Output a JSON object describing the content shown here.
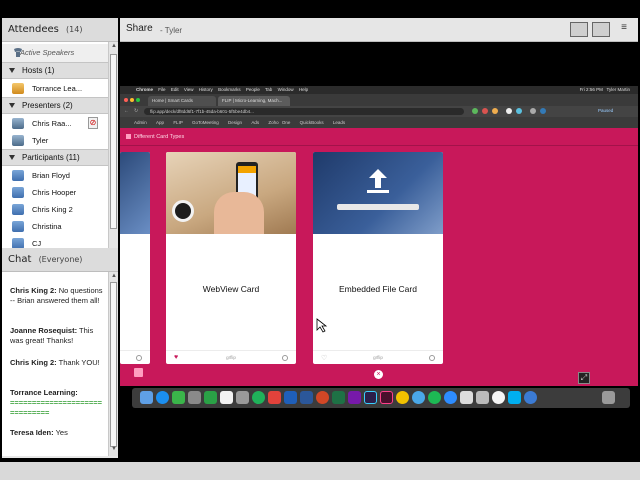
{
  "attendees": {
    "title": "Attendees",
    "count": "(14)",
    "active_speakers": "Active Speakers",
    "hosts_label": "Hosts (1)",
    "hosts": [
      "Torrance Lea..."
    ],
    "presenters_label": "Presenters (2)",
    "presenters": [
      "Chris Raa...",
      "Tyler"
    ],
    "participants_label": "Participants (11)",
    "participants": [
      "Brian Floyd",
      "Chris Hooper",
      "Chris King 2",
      "Christina",
      "CJ"
    ]
  },
  "chat": {
    "title": "Chat",
    "scope": "(Everyone)",
    "messages": [
      {
        "sender": "Chris King 2:",
        "text": "No questions -- Brian answered them all!"
      },
      {
        "sender": "Joanne Rosequist:",
        "text": "This was great! Thanks!"
      },
      {
        "sender": "Chris King 2:",
        "text": "Thank YOU!"
      },
      {
        "sender": "Torrance Learning:",
        "text": "=============================="
      },
      {
        "sender": "Teresa Iden:",
        "text": "Yes"
      }
    ]
  },
  "share": {
    "title": "Share",
    "presenter": "- Tyler"
  },
  "screen": {
    "menubar_items": [
      "Chrome",
      "File",
      "Edit",
      "View",
      "History",
      "Bookmarks",
      "People",
      "Tab",
      "Window",
      "Help"
    ],
    "menubar_right": "Fri 2:56 PM   Tyler Martin",
    "tabs": [
      "Home | Smart Cards",
      "FLIP | Micro-Learning, Mach..."
    ],
    "url": "flip.app/deck/df8dd6f1-7f1b-45da-b601-5f5be4db4...",
    "bookmarks": [
      "Admin",
      "App",
      "FLIP",
      "GoToMeeting",
      "Design",
      "Ads",
      "Zoho One",
      "QuickBooks",
      "Leads"
    ],
    "page_header": "Different Card Types",
    "cards": [
      {
        "label": "WebView Card"
      },
      {
        "label": "Embedded File Card"
      }
    ],
    "card_logo": "grflip",
    "paused": "Paused"
  },
  "colors": {
    "page_bg": "#c8185a",
    "chat_green": "#2e9b2e"
  }
}
